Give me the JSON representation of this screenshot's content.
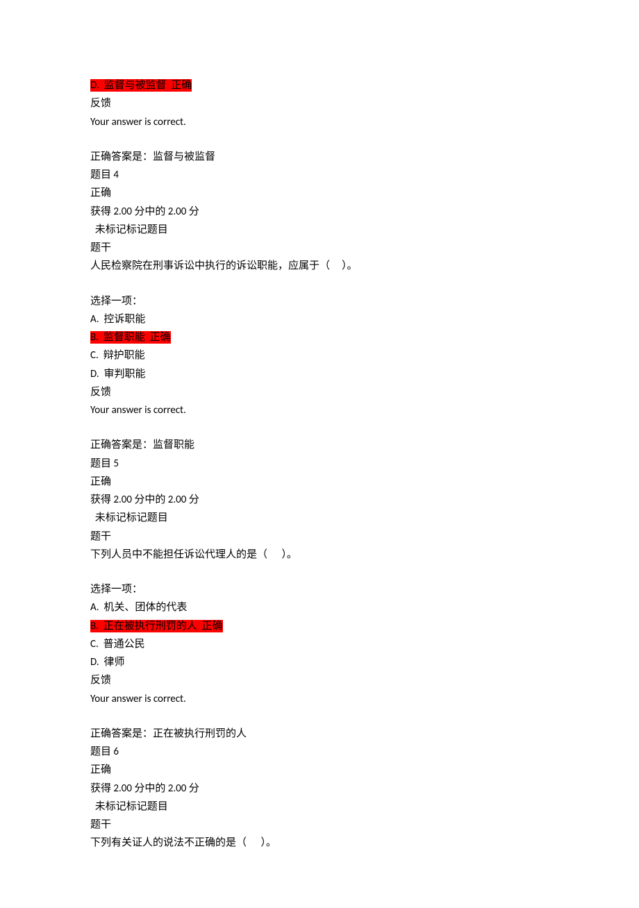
{
  "q3": {
    "opt_d": "D.  监督与被监督  正确",
    "feedback_label": "反馈",
    "feedback_text": "Your answer is correct.",
    "correct_answer": "正确答案是：监督与被监督"
  },
  "q4": {
    "title": "题目 4",
    "status": "正确",
    "score": "获得 2.00 分中的 2.00 分",
    "flag": "  未标记标记题目",
    "stem_label": "题干",
    "stem_text": "人民检察院在刑事诉讼中执行的诉讼职能，应属于（     ）。",
    "choose_label": "选择一项：",
    "opt_a": "A.  控诉职能",
    "opt_b": "B.  监督职能  正确",
    "opt_c": "C.  辩护职能",
    "opt_d": "D.  审判职能",
    "feedback_label": "反馈",
    "feedback_text": "Your answer is correct.",
    "correct_answer": "正确答案是：监督职能"
  },
  "q5": {
    "title": "题目 5",
    "status": "正确",
    "score": "获得 2.00 分中的 2.00 分",
    "flag": "  未标记标记题目",
    "stem_label": "题干",
    "stem_text": "下列人员中不能担任诉讼代理人的是（      ）。",
    "choose_label": "选择一项：",
    "opt_a": "A.  机关、团体的代表",
    "opt_b": "B.  正在被执行刑罚的人  正确",
    "opt_c": "C.  普通公民",
    "opt_d": "D.  律师",
    "feedback_label": "反馈",
    "feedback_text": "Your answer is correct.",
    "correct_answer": "正确答案是：正在被执行刑罚的人"
  },
  "q6": {
    "title": "题目 6",
    "status": "正确",
    "score": "获得 2.00 分中的 2.00 分",
    "flag": "  未标记标记题目",
    "stem_label": "题干",
    "stem_text": "下列有关证人的说法不正确的是（      ）。"
  }
}
